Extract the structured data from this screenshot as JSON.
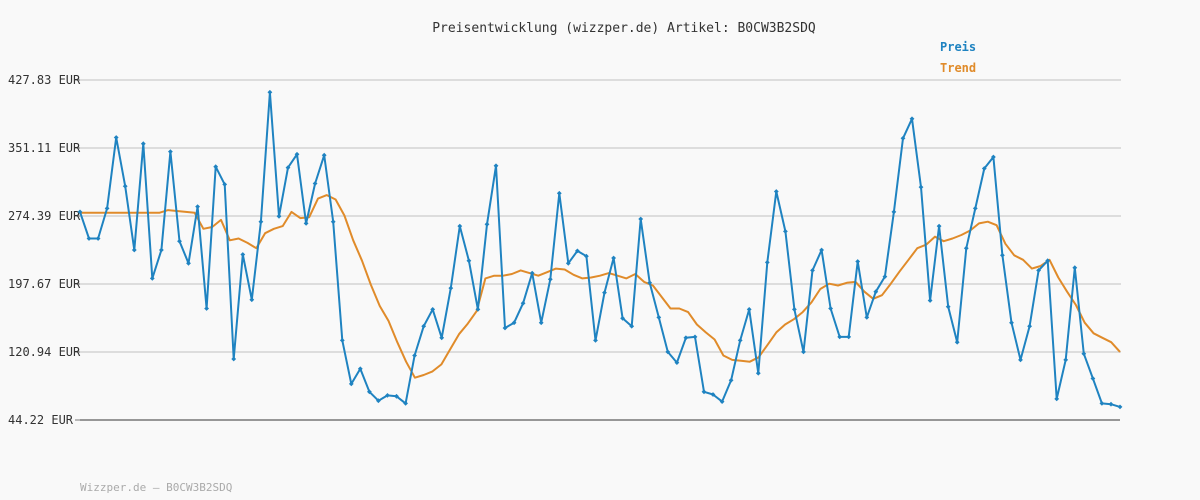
{
  "chart_data": {
    "type": "line",
    "title": "Preisentwicklung (wizzper.de) Artikel: B0CW3B2SDQ",
    "xlabel": "",
    "ylabel": "",
    "ylim": [
      44.22,
      427.83
    ],
    "yticks": [
      "427.83 EUR",
      "351.11 EUR",
      "274.39 EUR",
      "197.67 EUR",
      "120.94 EUR",
      "44.22 EUR"
    ],
    "grid": true,
    "legend_position": "top-right",
    "series": [
      {
        "name": "Preis",
        "color": "#1f83c1",
        "values": [
          279,
          249,
          249,
          283,
          363,
          308,
          236,
          356,
          204,
          236,
          347,
          246,
          221,
          285,
          170,
          330,
          310,
          113,
          231,
          180,
          268,
          414,
          274,
          329,
          344,
          266,
          311,
          343,
          268,
          134,
          85,
          102,
          76,
          66,
          72,
          71,
          63,
          117,
          150,
          169,
          137,
          193,
          263,
          224,
          169,
          265,
          331,
          148,
          154,
          176,
          210,
          154,
          203,
          300,
          221,
          235,
          229,
          134,
          188,
          227,
          159,
          150,
          271,
          199,
          160,
          121,
          109,
          137,
          138,
          76,
          73,
          65,
          89,
          134,
          169,
          97,
          222,
          302,
          257,
          169,
          121,
          213,
          236,
          170,
          138,
          138,
          223,
          160,
          189,
          206,
          279,
          362,
          384,
          307,
          179,
          263,
          172,
          132,
          238,
          283,
          328,
          341,
          230,
          154,
          112,
          150,
          213,
          224,
          68,
          112,
          216,
          119,
          91,
          63,
          62,
          59
        ],
        "markers": true
      },
      {
        "name": "Trend",
        "color": "#e08b2a",
        "values": [
          278,
          278,
          278,
          278,
          278,
          278,
          278,
          278,
          278,
          278,
          281,
          280,
          279,
          278,
          260,
          262,
          270,
          247,
          249,
          244,
          238,
          255,
          260,
          263,
          279,
          272,
          273,
          294,
          298,
          293,
          275,
          247,
          224,
          197,
          173,
          156,
          132,
          110,
          92,
          95,
          99,
          107,
          124,
          141,
          153,
          167,
          204,
          207,
          207,
          209,
          213,
          210,
          207,
          211,
          215,
          214,
          208,
          204,
          205,
          207,
          210,
          207,
          204,
          209,
          200,
          196,
          183,
          170,
          170,
          166,
          152,
          143,
          135,
          117,
          112,
          111,
          110,
          115,
          129,
          143,
          152,
          158,
          166,
          177,
          192,
          198,
          196,
          199,
          200,
          189,
          181,
          185,
          198,
          212,
          225,
          238,
          242,
          251,
          246,
          249,
          253,
          258,
          266,
          268,
          264,
          243,
          230,
          225,
          215,
          218,
          225,
          205,
          189,
          174,
          154,
          142,
          137,
          132,
          121
        ]
      }
    ]
  },
  "footer": {
    "text": "Wizzper.de – B0CW3B2SDQ"
  }
}
